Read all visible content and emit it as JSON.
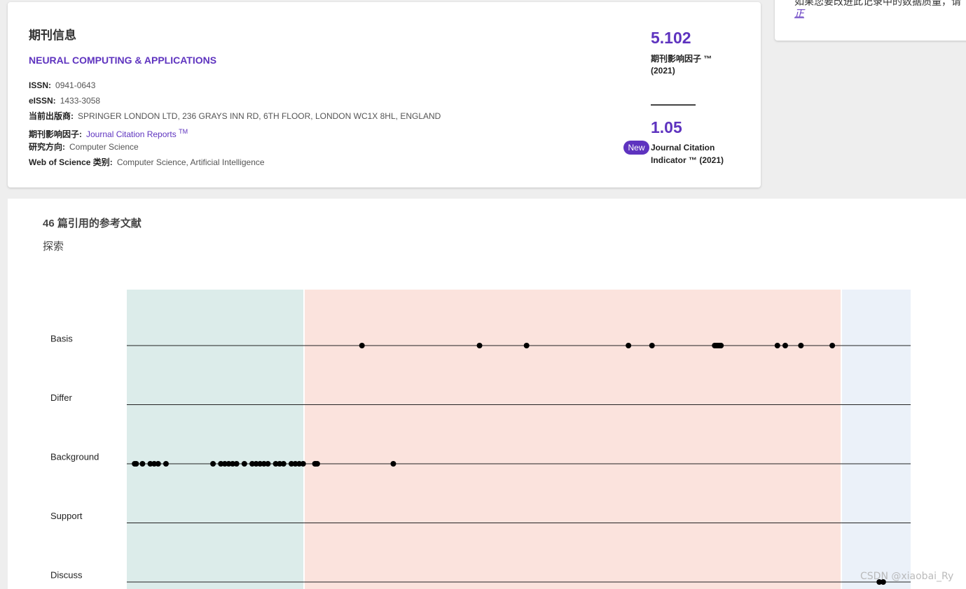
{
  "journal": {
    "title": "期刊信息",
    "name": "NEURAL COMPUTING & APPLICATIONS",
    "issn_label": "ISSN:",
    "issn": "0941-0643",
    "eissn_label": "eISSN:",
    "eissn": "1433-3058",
    "publisher_label": "当前出版商:",
    "publisher": "SPRINGER LONDON LTD, 236 GRAYS INN RD, 6TH FLOOR, LONDON WC1X 8HL, ENGLAND",
    "jif_label": "期刊影响因子:",
    "jif_link": "Journal Citation Reports",
    "jif_tm": "TM",
    "research_label": "研究方向:",
    "research": "Computer Science",
    "wos_label": "Web of Science 类别:",
    "wos": "Computer Science, Artificial Intelligence"
  },
  "metrics": {
    "jif_value": "5.102",
    "jif_caption_line1": "期刊影响因子 ™",
    "jif_caption_line2": "(2021)",
    "jci_value": "1.05",
    "new_badge": "New",
    "jci_caption_line1": "Journal Citation",
    "jci_caption_line2": "Indicator ™ (2021)"
  },
  "side": {
    "text": "如果您要改进此记录中的数据质量，请",
    "link": "正"
  },
  "refs": {
    "title": "46 篇引用的参考文献",
    "subtitle": "探索"
  },
  "chart_data": {
    "type": "scatter",
    "rows": [
      "Basis",
      "Differ",
      "Background",
      "Support",
      "Discuss"
    ],
    "regions": [
      {
        "color": "#dcecea"
      },
      {
        "color": "#fbe3dd"
      },
      {
        "color": "#ebf1f9"
      }
    ],
    "points": {
      "Basis": [
        0.3,
        0.45,
        0.51,
        0.64,
        0.67,
        0.75,
        0.752,
        0.754,
        0.756,
        0.758,
        0.83,
        0.84,
        0.86,
        0.9
      ],
      "Differ": [],
      "Background": [
        0.01,
        0.012,
        0.02,
        0.03,
        0.035,
        0.04,
        0.05,
        0.11,
        0.12,
        0.125,
        0.13,
        0.135,
        0.14,
        0.15,
        0.16,
        0.165,
        0.17,
        0.175,
        0.18,
        0.19,
        0.195,
        0.2,
        0.21,
        0.215,
        0.22,
        0.225,
        0.24,
        0.241,
        0.243,
        0.34
      ],
      "Support": [],
      "Discuss": [
        0.96,
        0.965
      ]
    }
  },
  "watermark": "CSDN @xiaobai_Ry"
}
